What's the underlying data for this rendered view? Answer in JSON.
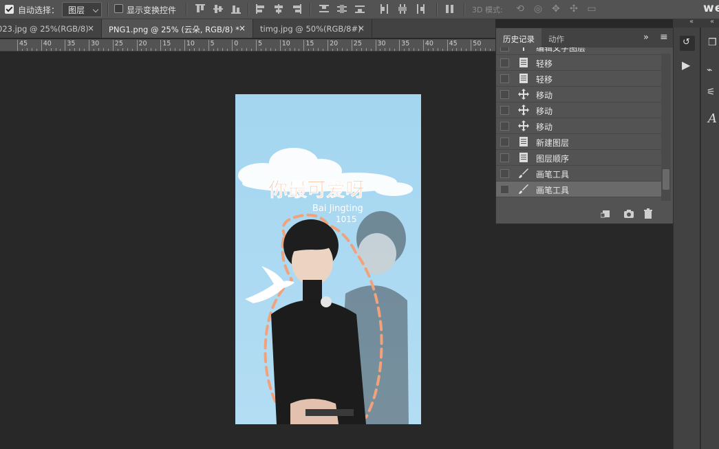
{
  "options_bar": {
    "auto_select_label": "自动选择：",
    "auto_select_checked": true,
    "layer_select_value": "图层",
    "show_transform_label": "显示变换控件",
    "show_transform_checked": false,
    "mode3d_label": "3D 模式:",
    "brand_text": "we"
  },
  "tabs": [
    {
      "label": "023.jpg @ 25%(RGB/8)",
      "close": "×"
    },
    {
      "label": "PNG1.png @ 25% (云朵, RGB/8) *",
      "close": "×",
      "active": true
    },
    {
      "label": "timg.jpg @ 50%(RGB/8#)",
      "close": "×"
    }
  ],
  "ruler": {
    "labels": [
      "45",
      "40",
      "35",
      "30",
      "25",
      "20",
      "15",
      "10",
      "5",
      "0",
      "5",
      "10",
      "15",
      "20",
      "25",
      "30",
      "35",
      "40",
      "45",
      "50"
    ]
  },
  "document": {
    "title_text": "你最可爱呀",
    "subtitle_text": "Bai Jingting",
    "number_text": "1015"
  },
  "history_panel": {
    "tab_history": "历史记录",
    "tab_actions": "动作",
    "expand": "»",
    "menu": "≡",
    "items": [
      {
        "label": "编辑文字图层",
        "icon": "text-icon"
      },
      {
        "label": "轻移",
        "icon": "document-icon"
      },
      {
        "label": "轻移",
        "icon": "document-icon"
      },
      {
        "label": "移动",
        "icon": "move-icon"
      },
      {
        "label": "移动",
        "icon": "move-icon"
      },
      {
        "label": "移动",
        "icon": "move-icon"
      },
      {
        "label": "新建图层",
        "icon": "document-icon"
      },
      {
        "label": "图层顺序",
        "icon": "document-icon"
      },
      {
        "label": "画笔工具",
        "icon": "brush-icon"
      },
      {
        "label": "画笔工具",
        "icon": "brush-icon",
        "selected": true
      }
    ]
  },
  "colors": {
    "background": "#282828",
    "panel": "#535353",
    "dark_panel": "#424242",
    "doc_sky": "#a9d8f1",
    "title_orange": "#f0a070"
  }
}
